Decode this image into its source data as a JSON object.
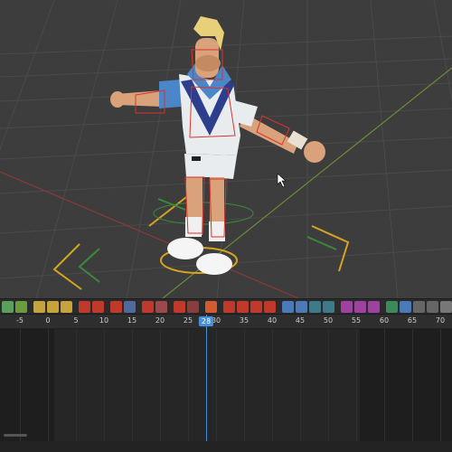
{
  "toolbar": {
    "buttons": [
      {
        "icon": "keyframe-icon",
        "color": "#5aa05a"
      },
      {
        "icon": "key-icon",
        "color": "#6a9c3d"
      },
      {
        "icon": "sep"
      },
      {
        "icon": "key-insert-icon",
        "color": "#c8a23a"
      },
      {
        "icon": "key-delete-icon",
        "color": "#c8a23a"
      },
      {
        "icon": "key-filter-icon",
        "color": "#c8a23a"
      },
      {
        "icon": "sep"
      },
      {
        "icon": "curve-icon",
        "color": "#c0392b"
      },
      {
        "icon": "curve-ease-icon",
        "color": "#c0392b"
      },
      {
        "icon": "sep"
      },
      {
        "icon": "motion-icon",
        "color": "#c0392b"
      },
      {
        "icon": "motion2-icon",
        "color": "#4f6a9e"
      },
      {
        "icon": "sep"
      },
      {
        "icon": "bone-icon",
        "color": "#c0392b"
      },
      {
        "icon": "bone2-icon",
        "color": "#9a4a4a"
      },
      {
        "icon": "sep"
      },
      {
        "icon": "pose-icon",
        "color": "#c0392b"
      },
      {
        "icon": "pose2-icon",
        "color": "#8a3d3d"
      },
      {
        "icon": "sep"
      },
      {
        "icon": "person-icon",
        "color": "#d45a30"
      },
      {
        "icon": "sep"
      },
      {
        "icon": "lock-icon",
        "color": "#c0392b"
      },
      {
        "icon": "graph-icon",
        "color": "#c0392b"
      },
      {
        "icon": "rotate-icon",
        "color": "#c0392b"
      },
      {
        "icon": "scale-icon",
        "color": "#c0392b"
      },
      {
        "icon": "sep"
      },
      {
        "icon": "marker-icon",
        "color": "#4a7ab8"
      },
      {
        "icon": "select-icon",
        "color": "#4a7ab8"
      },
      {
        "icon": "frame-icon",
        "color": "#3d7a8a"
      },
      {
        "icon": "frame2-icon",
        "color": "#3d7a8a"
      },
      {
        "icon": "sep"
      },
      {
        "icon": "random-icon",
        "color": "#a040a0"
      },
      {
        "icon": "tween-icon",
        "color": "#a040a0"
      },
      {
        "icon": "tween2-icon",
        "color": "#a040a0"
      },
      {
        "icon": "sep"
      },
      {
        "icon": "bake-icon",
        "color": "#3a8a5a"
      },
      {
        "icon": "curve-editor-icon",
        "color": "#4a7ab8"
      },
      {
        "icon": "copy-icon",
        "color": "#666666"
      },
      {
        "icon": "paste-icon",
        "color": "#666666"
      },
      {
        "icon": "settings-icon",
        "color": "#777777"
      }
    ]
  },
  "ruler": {
    "ticks": [
      "-5",
      "0",
      "5",
      "10",
      "15",
      "20",
      "25",
      "30",
      "35",
      "40",
      "45",
      "50",
      "55",
      "60",
      "65",
      "70"
    ],
    "current_frame": "28"
  }
}
